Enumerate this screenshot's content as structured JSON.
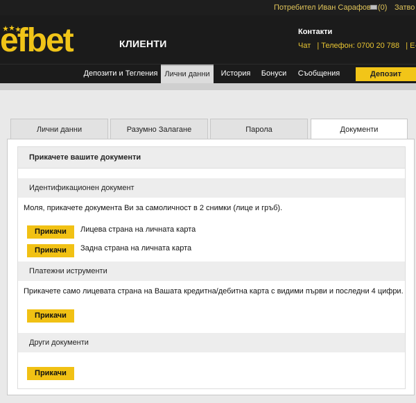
{
  "topbar": {
    "user_label": "Потребител Иван Сарафов",
    "messages_count": "(0)",
    "close_label": "Затво"
  },
  "header": {
    "logo_text": "efbet",
    "section_title": "КЛИЕНТИ",
    "contacts_title": "Контакти",
    "contacts_chat": "Чат",
    "contacts_phone": "| Телефон: 0700 20 788",
    "contacts_email": "| E-mail",
    "brand_color": "#f0c418"
  },
  "nav": {
    "items": [
      {
        "label": "Депозити и Тегления"
      },
      {
        "label": "Лични данни"
      },
      {
        "label": "История"
      },
      {
        "label": "Бонуси"
      },
      {
        "label": "Съобщения"
      }
    ],
    "active_index": 1,
    "deposit_label": "Депозит"
  },
  "tabs": {
    "items": [
      {
        "label": "Лични данни"
      },
      {
        "label": "Разумно Залагане"
      },
      {
        "label": "Парола"
      },
      {
        "label": "Документи"
      }
    ],
    "active_index": 3
  },
  "documents": {
    "title": "Прикачете вашите документи",
    "id_section": {
      "header": "Идентификационен документ",
      "instructions": "Моля, прикачете документа Ви за самоличност в 2 снимки (лице и гръб).",
      "front_button": "Прикачи",
      "front_label": "Лицева страна на личната карта",
      "back_button": "Прикачи",
      "back_label": "Задна страна на личната карта"
    },
    "payment_section": {
      "header": "Платежни иструменти",
      "instructions": "Прикачете само лицевата страна на Вашата кредитна/дебитна карта с видими първи и последни 4 цифри.",
      "button": "Прикачи"
    },
    "other_section": {
      "header": "Други документи",
      "button": "Прикачи"
    }
  },
  "icons": {
    "messages": "envelope-icon",
    "logo_stars": "stars-icon"
  }
}
